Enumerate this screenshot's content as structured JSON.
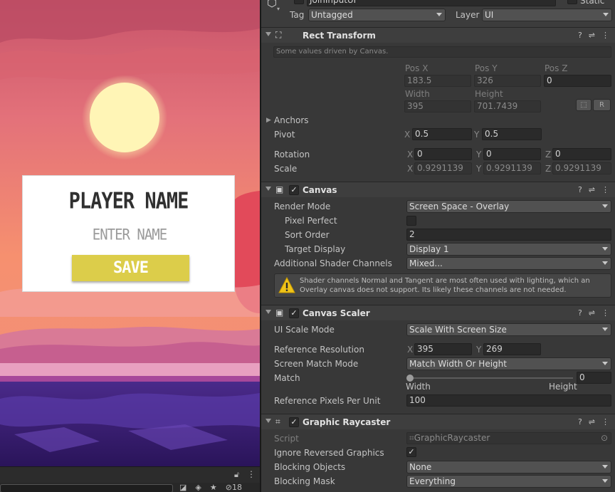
{
  "game_ui": {
    "title": "PLAYER NAME",
    "name_placeholder": "ENTER NAME",
    "save_label": "SAVE",
    "colors": {
      "sky_top": "#c8546a",
      "sky_bottom": "#f79a6e",
      "sun": "#fff5b6",
      "save_button": "#dccd4a",
      "ground": "#3d1f78"
    }
  },
  "game_footer": {
    "layer_count": "18"
  },
  "inspector": {
    "header": {
      "object_name": "JoinInputUI",
      "static_label": "Static",
      "tag_label": "Tag",
      "tag_value": "Untagged",
      "layer_label": "Layer",
      "layer_value": "UI"
    },
    "rect_transform": {
      "name": "Rect Transform",
      "note": "Some values driven by Canvas.",
      "pos_x_label": "Pos X",
      "pos_x": "183.5",
      "pos_y_label": "Pos Y",
      "pos_y": "326",
      "pos_z_label": "Pos Z",
      "pos_z": "0",
      "width_label": "Width",
      "width": "395",
      "height_label": "Height",
      "height": "701.7439",
      "anchors_label": "Anchors",
      "pivot_label": "Pivot",
      "pivot_x": "0.5",
      "pivot_y": "0.5",
      "rotation_label": "Rotation",
      "rot_x": "0",
      "rot_y": "0",
      "rot_z": "0",
      "scale_label": "Scale",
      "scale_x": "0.9291139",
      "scale_y": "0.9291139",
      "scale_z": "0.9291139",
      "r_button": "R"
    },
    "canvas": {
      "name": "Canvas",
      "render_mode_label": "Render Mode",
      "render_mode": "Screen Space - Overlay",
      "pixel_perfect_label": "Pixel Perfect",
      "sort_order_label": "Sort Order",
      "sort_order": "2",
      "target_display_label": "Target Display",
      "target_display": "Display 1",
      "shader_channels_label": "Additional Shader Channels",
      "shader_channels": "Mixed...",
      "warning": "Shader channels Normal and Tangent are most often used with lighting, which an Overlay canvas does not support. Its likely these channels are not needed."
    },
    "canvas_scaler": {
      "name": "Canvas Scaler",
      "ui_scale_mode_label": "UI Scale Mode",
      "ui_scale_mode": "Scale With Screen Size",
      "ref_res_label": "Reference Resolution",
      "ref_x": "395",
      "ref_y": "269",
      "match_mode_label": "Screen Match Mode",
      "match_mode": "Match Width Or Height",
      "match_label": "Match",
      "match_value": "0",
      "match_width": "Width",
      "match_height": "Height",
      "ppu_label": "Reference Pixels Per Unit",
      "ppu": "100"
    },
    "graphic_raycaster": {
      "name": "Graphic Raycaster",
      "script_label": "Script",
      "script_value": "GraphicRaycaster",
      "ignore_reversed_label": "Ignore Reversed Graphics",
      "blocking_objects_label": "Blocking Objects",
      "blocking_objects": "None",
      "blocking_mask_label": "Blocking Mask",
      "blocking_mask": "Everything"
    },
    "axis_letters": {
      "x": "X",
      "y": "Y",
      "z": "Z"
    }
  }
}
